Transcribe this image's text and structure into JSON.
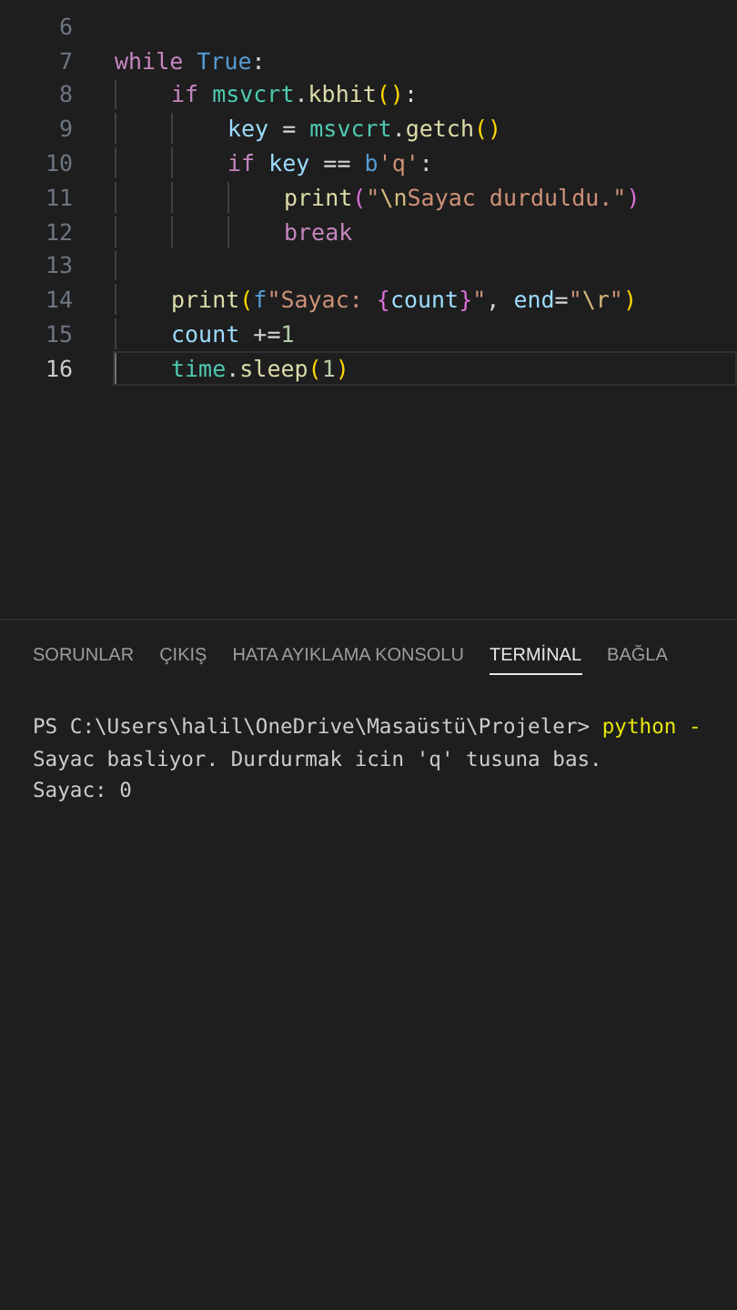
{
  "editor": {
    "lines": [
      {
        "number": "6",
        "current": false
      },
      {
        "number": "7",
        "current": false,
        "tokens": [
          {
            "text": "while ",
            "kind": "keyword"
          },
          {
            "text": "True",
            "kind": "constant"
          },
          {
            "text": ":",
            "kind": "plain"
          }
        ],
        "children": [
          {
            "number": "8",
            "current": false,
            "tokens": [
              {
                "text": "if ",
                "kind": "keyword"
              },
              {
                "text": "msvcrt",
                "kind": "module"
              },
              {
                "text": ".",
                "kind": "plain"
              },
              {
                "text": "kbhit",
                "kind": "function"
              },
              {
                "text": "()",
                "kind": "bracket"
              },
              {
                "text": ":",
                "kind": "plain"
              }
            ],
            "children": [
              {
                "number": "9",
                "current": false,
                "tokens": [
                  {
                    "text": "key",
                    "kind": "variable"
                  },
                  {
                    "text": " = ",
                    "kind": "plain"
                  },
                  {
                    "text": "msvcrt",
                    "kind": "module"
                  },
                  {
                    "text": ".",
                    "kind": "plain"
                  },
                  {
                    "text": "getch",
                    "kind": "function"
                  },
                  {
                    "text": "()",
                    "kind": "bracket"
                  }
                ]
              },
              {
                "number": "10",
                "current": false,
                "tokens": [
                  {
                    "text": "if ",
                    "kind": "keyword"
                  },
                  {
                    "text": "key",
                    "kind": "variable"
                  },
                  {
                    "text": " == ",
                    "kind": "plain"
                  },
                  {
                    "text": "b",
                    "kind": "constant"
                  },
                  {
                    "text": "'q'",
                    "kind": "string"
                  },
                  {
                    "text": ":",
                    "kind": "plain"
                  }
                ],
                "children": [
                  {
                    "number": "11",
                    "current": false,
                    "tokens": [
                      {
                        "text": "print",
                        "kind": "function"
                      },
                      {
                        "text": "(",
                        "kind": "bracket2"
                      },
                      {
                        "text": "\"",
                        "kind": "string"
                      },
                      {
                        "text": "\\n",
                        "kind": "escape"
                      },
                      {
                        "text": "Sayac durduldu.\"",
                        "kind": "string"
                      },
                      {
                        "text": ")",
                        "kind": "bracket2"
                      }
                    ]
                  },
                  {
                    "number": "12",
                    "current": false,
                    "tokens": [
                      {
                        "text": "break",
                        "kind": "keyword"
                      }
                    ]
                  }
                ]
              }
            ]
          },
          {
            "number": "13",
            "current": false
          },
          {
            "number": "14",
            "current": false,
            "tokens": [
              {
                "text": "print",
                "kind": "function"
              },
              {
                "text": "(",
                "kind": "bracket"
              },
              {
                "text": "f",
                "kind": "constant"
              },
              {
                "text": "\"Sayac: ",
                "kind": "string"
              },
              {
                "text": "{",
                "kind": "bracket2"
              },
              {
                "text": "count",
                "kind": "variable"
              },
              {
                "text": "}",
                "kind": "bracket2"
              },
              {
                "text": "\"",
                "kind": "string"
              },
              {
                "text": ", ",
                "kind": "plain"
              },
              {
                "text": "end",
                "kind": "variable"
              },
              {
                "text": "=",
                "kind": "plain"
              },
              {
                "text": "\"",
                "kind": "string"
              },
              {
                "text": "\\r",
                "kind": "escape"
              },
              {
                "text": "\"",
                "kind": "string"
              },
              {
                "text": ")",
                "kind": "bracket"
              }
            ]
          },
          {
            "number": "15",
            "current": false,
            "tokens": [
              {
                "text": "count",
                "kind": "variable"
              },
              {
                "text": " +=",
                "kind": "plain"
              },
              {
                "text": "1",
                "kind": "number"
              }
            ]
          },
          {
            "number": "16",
            "current": true,
            "tokens": [
              {
                "text": "time",
                "kind": "module"
              },
              {
                "text": ".",
                "kind": "plain"
              },
              {
                "text": "sleep",
                "kind": "function"
              },
              {
                "text": "(",
                "kind": "bracket"
              },
              {
                "text": "1",
                "kind": "number"
              },
              {
                "text": ")",
                "kind": "bracket"
              }
            ]
          }
        ]
      }
    ]
  },
  "panel": {
    "tabs": [
      {
        "label": "SORUNLAR",
        "selected": false
      },
      {
        "label": "ÇIKIŞ",
        "selected": false
      },
      {
        "label": "HATA AYIKLAMA KONSOLU",
        "selected": false
      },
      {
        "label": "TERMİNAL",
        "selected": true
      },
      {
        "label": "BAĞLA",
        "selected": false
      }
    ],
    "terminal": {
      "prompt": "PS C:\\Users\\halil\\OneDrive\\Masaüstü\\Projeler>",
      "command": "python -",
      "output": [
        "Sayac basliyor. Durdurmak icin 'q' tusuna bas.",
        "Sayac: 0"
      ]
    }
  }
}
